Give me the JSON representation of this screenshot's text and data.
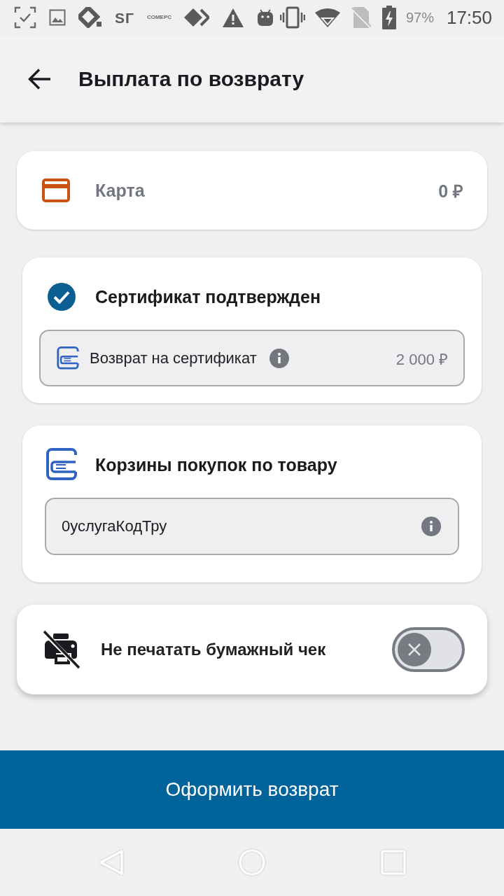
{
  "status_bar": {
    "app_labels": [
      "SГ",
      "COMEPC"
    ],
    "battery_percent": "97%",
    "time": "17:50"
  },
  "header": {
    "title": "Выплата по возврату"
  },
  "payment": {
    "label": "Карта",
    "amount": "0 ₽"
  },
  "certificate": {
    "title": "Сертификат подтвержден",
    "confirmed": true,
    "refund_label": "Возврат на сертификат",
    "refund_amount": "2 000 ₽"
  },
  "cart": {
    "title": "Корзины покупок по товару",
    "value": "0услугаКодТру"
  },
  "receipt_option": {
    "label": "Не печатать бумажный чек",
    "on": false
  },
  "submit_button": "Оформить возврат"
}
